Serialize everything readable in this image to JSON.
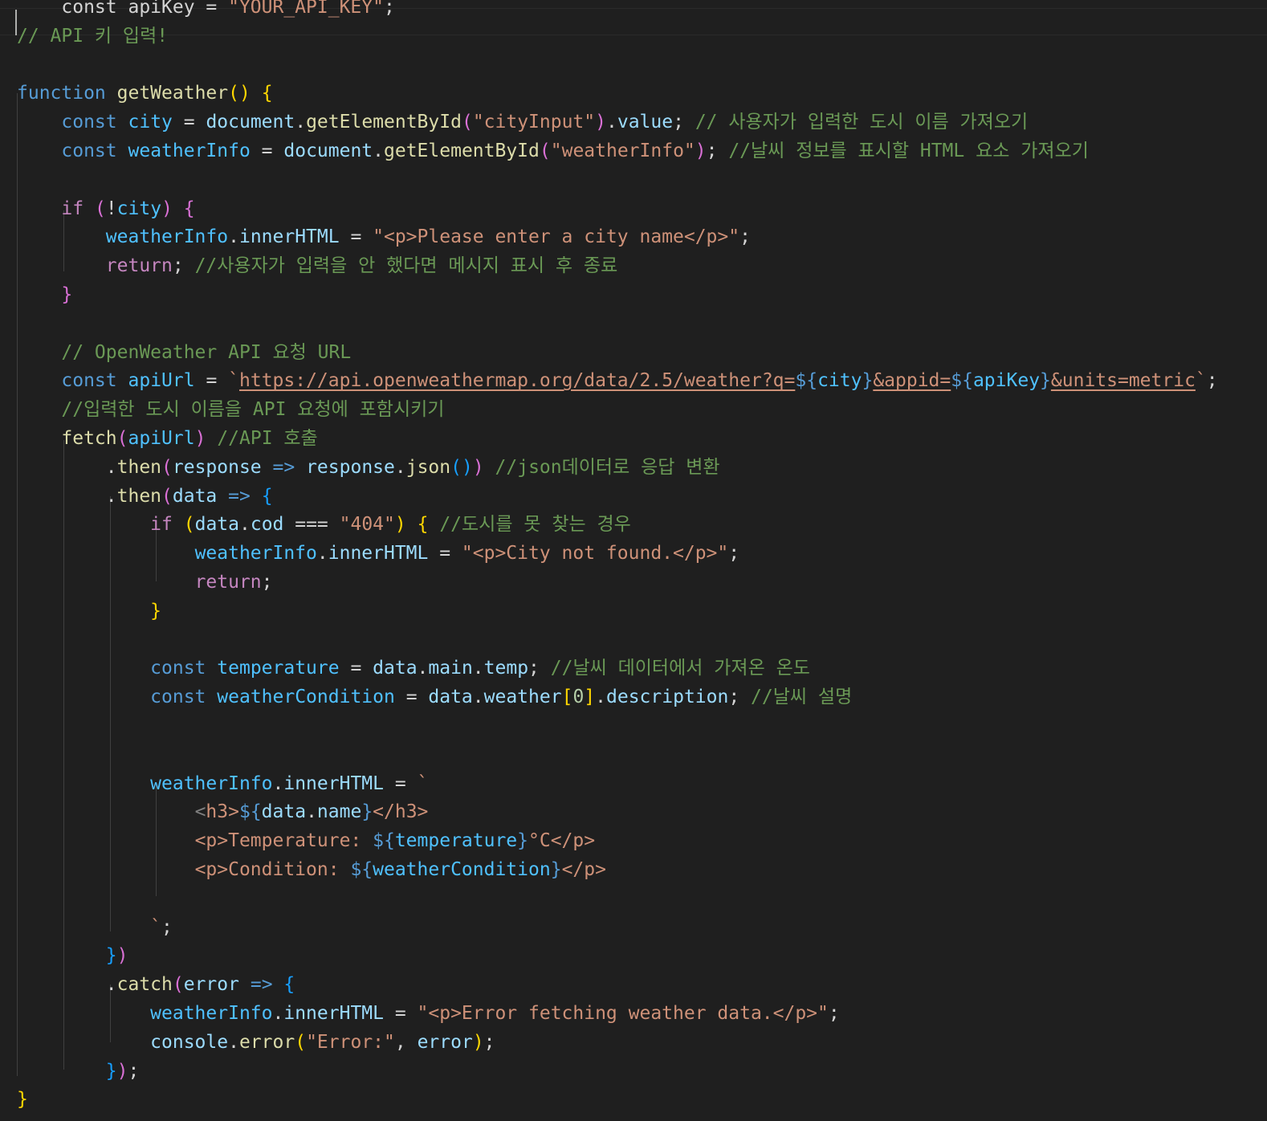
{
  "editor": {
    "language": "javascript",
    "theme_colors": {
      "background": "#1f1f1f",
      "keyword": "#569cd6",
      "control": "#c586c0",
      "function": "#dcdcaa",
      "variable": "#4fc1ff",
      "property": "#9cdcfe",
      "string": "#ce9178",
      "comment": "#6a9955",
      "number": "#b5cea8"
    },
    "lines": [
      {
        "segs": [
          [
            "c-plain",
            "    const apiKey = "
          ],
          [
            "c-str",
            "\"YOUR_API_KEY\""
          ],
          [
            "c-plain",
            ";"
          ]
        ]
      },
      {
        "segs": [
          [
            "c-cmt",
            "// API 키 입력!"
          ]
        ]
      },
      {
        "segs": []
      },
      {
        "segs": [
          [
            "c-kw",
            "function"
          ],
          [
            "c-plain",
            " "
          ],
          [
            "c-fn",
            "getWeather"
          ],
          [
            "c-br1",
            "()"
          ],
          [
            "c-plain",
            " "
          ],
          [
            "c-br1",
            "{"
          ]
        ]
      },
      {
        "segs": [
          [
            "c-plain",
            "    "
          ],
          [
            "c-kw",
            "const"
          ],
          [
            "c-plain",
            " "
          ],
          [
            "c-var",
            "city"
          ],
          [
            "c-plain",
            " = "
          ],
          [
            "c-prop",
            "document"
          ],
          [
            "c-plain",
            "."
          ],
          [
            "c-fn",
            "getElementById"
          ],
          [
            "c-br2",
            "("
          ],
          [
            "c-str",
            "\"cityInput\""
          ],
          [
            "c-br2",
            ")"
          ],
          [
            "c-plain",
            "."
          ],
          [
            "c-prop",
            "value"
          ],
          [
            "c-plain",
            "; "
          ],
          [
            "c-cmt",
            "// 사용자가 입력한 도시 이름 가져오기"
          ]
        ]
      },
      {
        "segs": [
          [
            "c-plain",
            "    "
          ],
          [
            "c-kw",
            "const"
          ],
          [
            "c-plain",
            " "
          ],
          [
            "c-var",
            "weatherInfo"
          ],
          [
            "c-plain",
            " = "
          ],
          [
            "c-prop",
            "document"
          ],
          [
            "c-plain",
            "."
          ],
          [
            "c-fn",
            "getElementById"
          ],
          [
            "c-br2",
            "("
          ],
          [
            "c-str",
            "\"weatherInfo\""
          ],
          [
            "c-br2",
            ")"
          ],
          [
            "c-plain",
            "; "
          ],
          [
            "c-cmt",
            "//날씨 정보를 표시할 HTML 요소 가져오기"
          ]
        ]
      },
      {
        "segs": []
      },
      {
        "segs": [
          [
            "c-plain",
            "    "
          ],
          [
            "c-ctl",
            "if"
          ],
          [
            "c-plain",
            " "
          ],
          [
            "c-br2",
            "("
          ],
          [
            "c-plain",
            "!"
          ],
          [
            "c-var",
            "city"
          ],
          [
            "c-br2",
            ")"
          ],
          [
            "c-plain",
            " "
          ],
          [
            "c-br2",
            "{"
          ]
        ]
      },
      {
        "segs": [
          [
            "c-plain",
            "        "
          ],
          [
            "c-var",
            "weatherInfo"
          ],
          [
            "c-plain",
            "."
          ],
          [
            "c-prop",
            "innerHTML"
          ],
          [
            "c-plain",
            " = "
          ],
          [
            "c-str",
            "\"<p>Please enter a city name</p>\""
          ],
          [
            "c-plain",
            ";"
          ]
        ]
      },
      {
        "segs": [
          [
            "c-plain",
            "        "
          ],
          [
            "c-ctl",
            "return"
          ],
          [
            "c-plain",
            "; "
          ],
          [
            "c-cmt",
            "//사용자가 입력을 안 했다면 메시지 표시 후 종료"
          ]
        ]
      },
      {
        "segs": [
          [
            "c-plain",
            "    "
          ],
          [
            "c-br2",
            "}"
          ]
        ]
      },
      {
        "segs": []
      },
      {
        "segs": [
          [
            "c-plain",
            "    "
          ],
          [
            "c-cmt",
            "// OpenWeather API 요청 URL"
          ]
        ]
      },
      {
        "segs": [
          [
            "c-plain",
            "    "
          ],
          [
            "c-kw",
            "const"
          ],
          [
            "c-plain",
            " "
          ],
          [
            "c-var",
            "apiUrl"
          ],
          [
            "c-plain",
            " = "
          ],
          [
            "c-str",
            "`"
          ],
          [
            "c-link",
            "https://api.openweathermap.org/data/2.5/weather?q="
          ],
          [
            "c-tpl",
            "${"
          ],
          [
            "c-var",
            "city"
          ],
          [
            "c-tpl",
            "}"
          ],
          [
            "c-link",
            "&appid="
          ],
          [
            "c-tpl",
            "${"
          ],
          [
            "c-var",
            "apiKey"
          ],
          [
            "c-tpl",
            "}"
          ],
          [
            "c-link",
            "&units=metric"
          ],
          [
            "c-str",
            "`"
          ],
          [
            "c-plain",
            ";"
          ]
        ]
      },
      {
        "segs": [
          [
            "c-plain",
            "    "
          ],
          [
            "c-cmt",
            "//입력한 도시 이름을 API 요청에 포함시키기"
          ]
        ]
      },
      {
        "segs": [
          [
            "c-plain",
            "    "
          ],
          [
            "c-fn",
            "fetch"
          ],
          [
            "c-br2",
            "("
          ],
          [
            "c-var",
            "apiUrl"
          ],
          [
            "c-br2",
            ")"
          ],
          [
            "c-plain",
            " "
          ],
          [
            "c-cmt",
            "//API 호출"
          ]
        ]
      },
      {
        "segs": [
          [
            "c-plain",
            "        ."
          ],
          [
            "c-fn",
            "then"
          ],
          [
            "c-br2",
            "("
          ],
          [
            "c-prop",
            "response"
          ],
          [
            "c-plain",
            " "
          ],
          [
            "c-kw",
            "=>"
          ],
          [
            "c-plain",
            " "
          ],
          [
            "c-prop",
            "response"
          ],
          [
            "c-plain",
            "."
          ],
          [
            "c-fn",
            "json"
          ],
          [
            "c-br3",
            "()"
          ],
          [
            "c-br2",
            ")"
          ],
          [
            "c-plain",
            " "
          ],
          [
            "c-cmt",
            "//json데이터로 응답 변환"
          ]
        ]
      },
      {
        "segs": [
          [
            "c-plain",
            "        ."
          ],
          [
            "c-fn",
            "then"
          ],
          [
            "c-br2",
            "("
          ],
          [
            "c-prop",
            "data"
          ],
          [
            "c-plain",
            " "
          ],
          [
            "c-kw",
            "=>"
          ],
          [
            "c-plain",
            " "
          ],
          [
            "c-br3",
            "{"
          ]
        ]
      },
      {
        "segs": [
          [
            "c-plain",
            "            "
          ],
          [
            "c-ctl",
            "if"
          ],
          [
            "c-plain",
            " "
          ],
          [
            "c-br1",
            "("
          ],
          [
            "c-prop",
            "data"
          ],
          [
            "c-plain",
            "."
          ],
          [
            "c-prop",
            "cod"
          ],
          [
            "c-plain",
            " === "
          ],
          [
            "c-str",
            "\"404\""
          ],
          [
            "c-br1",
            ")"
          ],
          [
            "c-plain",
            " "
          ],
          [
            "c-br1",
            "{"
          ],
          [
            "c-plain",
            " "
          ],
          [
            "c-cmt",
            "//도시를 못 찾는 경우"
          ]
        ]
      },
      {
        "segs": [
          [
            "c-plain",
            "                "
          ],
          [
            "c-var",
            "weatherInfo"
          ],
          [
            "c-plain",
            "."
          ],
          [
            "c-prop",
            "innerHTML"
          ],
          [
            "c-plain",
            " = "
          ],
          [
            "c-str",
            "\"<p>City not found.</p>\""
          ],
          [
            "c-plain",
            ";"
          ]
        ]
      },
      {
        "segs": [
          [
            "c-plain",
            "                "
          ],
          [
            "c-ctl",
            "return"
          ],
          [
            "c-plain",
            ";"
          ]
        ]
      },
      {
        "segs": [
          [
            "c-plain",
            "            "
          ],
          [
            "c-br1",
            "}"
          ]
        ]
      },
      {
        "segs": []
      },
      {
        "segs": [
          [
            "c-plain",
            "            "
          ],
          [
            "c-kw",
            "const"
          ],
          [
            "c-plain",
            " "
          ],
          [
            "c-var",
            "temperature"
          ],
          [
            "c-plain",
            " = "
          ],
          [
            "c-prop",
            "data"
          ],
          [
            "c-plain",
            "."
          ],
          [
            "c-prop",
            "main"
          ],
          [
            "c-plain",
            "."
          ],
          [
            "c-prop",
            "temp"
          ],
          [
            "c-plain",
            "; "
          ],
          [
            "c-cmt",
            "//날씨 데이터에서 가져온 온도"
          ]
        ]
      },
      {
        "segs": [
          [
            "c-plain",
            "            "
          ],
          [
            "c-kw",
            "const"
          ],
          [
            "c-plain",
            " "
          ],
          [
            "c-var",
            "weatherCondition"
          ],
          [
            "c-plain",
            " = "
          ],
          [
            "c-prop",
            "data"
          ],
          [
            "c-plain",
            "."
          ],
          [
            "c-prop",
            "weather"
          ],
          [
            "c-br1",
            "["
          ],
          [
            "c-num",
            "0"
          ],
          [
            "c-br1",
            "]"
          ],
          [
            "c-plain",
            "."
          ],
          [
            "c-prop",
            "description"
          ],
          [
            "c-plain",
            "; "
          ],
          [
            "c-cmt",
            "//날씨 설명"
          ]
        ]
      },
      {
        "segs": []
      },
      {
        "segs": []
      },
      {
        "segs": [
          [
            "c-plain",
            "            "
          ],
          [
            "c-var",
            "weatherInfo"
          ],
          [
            "c-plain",
            "."
          ],
          [
            "c-prop",
            "innerHTML"
          ],
          [
            "c-plain",
            " = "
          ],
          [
            "c-str",
            "`"
          ]
        ]
      },
      {
        "segs": [
          [
            "c-plain",
            "                "
          ],
          [
            "c-tag",
            "<"
          ],
          [
            "c-str",
            "h3>"
          ],
          [
            "c-tpl",
            "${"
          ],
          [
            "c-prop",
            "data"
          ],
          [
            "c-plain",
            "."
          ],
          [
            "c-prop",
            "name"
          ],
          [
            "c-tpl",
            "}"
          ],
          [
            "c-str",
            "</h3>"
          ]
        ]
      },
      {
        "segs": [
          [
            "c-plain",
            "                "
          ],
          [
            "c-str",
            "<p>Temperature: "
          ],
          [
            "c-tpl",
            "${"
          ],
          [
            "c-var",
            "temperature"
          ],
          [
            "c-tpl",
            "}"
          ],
          [
            "c-str",
            "°C</p>"
          ]
        ]
      },
      {
        "segs": [
          [
            "c-plain",
            "                "
          ],
          [
            "c-str",
            "<p>Condition: "
          ],
          [
            "c-tpl",
            "${"
          ],
          [
            "c-var",
            "weatherCondition"
          ],
          [
            "c-tpl",
            "}"
          ],
          [
            "c-str",
            "</p>"
          ]
        ]
      },
      {
        "segs": []
      },
      {
        "segs": [
          [
            "c-plain",
            "            "
          ],
          [
            "c-str",
            "`"
          ],
          [
            "c-plain",
            ";"
          ]
        ]
      },
      {
        "segs": [
          [
            "c-plain",
            "        "
          ],
          [
            "c-br3",
            "}"
          ],
          [
            "c-br2",
            ")"
          ]
        ]
      },
      {
        "segs": [
          [
            "c-plain",
            "        ."
          ],
          [
            "c-fn",
            "catch"
          ],
          [
            "c-br2",
            "("
          ],
          [
            "c-prop",
            "error"
          ],
          [
            "c-plain",
            " "
          ],
          [
            "c-kw",
            "=>"
          ],
          [
            "c-plain",
            " "
          ],
          [
            "c-br3",
            "{"
          ]
        ]
      },
      {
        "segs": [
          [
            "c-plain",
            "            "
          ],
          [
            "c-var",
            "weatherInfo"
          ],
          [
            "c-plain",
            "."
          ],
          [
            "c-prop",
            "innerHTML"
          ],
          [
            "c-plain",
            " = "
          ],
          [
            "c-str",
            "\"<p>Error fetching weather data.</p>\""
          ],
          [
            "c-plain",
            ";"
          ]
        ]
      },
      {
        "segs": [
          [
            "c-plain",
            "            "
          ],
          [
            "c-prop",
            "console"
          ],
          [
            "c-plain",
            "."
          ],
          [
            "c-fn",
            "error"
          ],
          [
            "c-br1",
            "("
          ],
          [
            "c-str",
            "\"Error:\""
          ],
          [
            "c-plain",
            ", "
          ],
          [
            "c-prop",
            "error"
          ],
          [
            "c-br1",
            ")"
          ],
          [
            "c-plain",
            ";"
          ]
        ]
      },
      {
        "segs": [
          [
            "c-plain",
            "        "
          ],
          [
            "c-br3",
            "}"
          ],
          [
            "c-br2",
            ")"
          ],
          [
            "c-plain",
            ";"
          ]
        ]
      },
      {
        "segs": [
          [
            "c-br1",
            "}"
          ]
        ]
      }
    ]
  }
}
